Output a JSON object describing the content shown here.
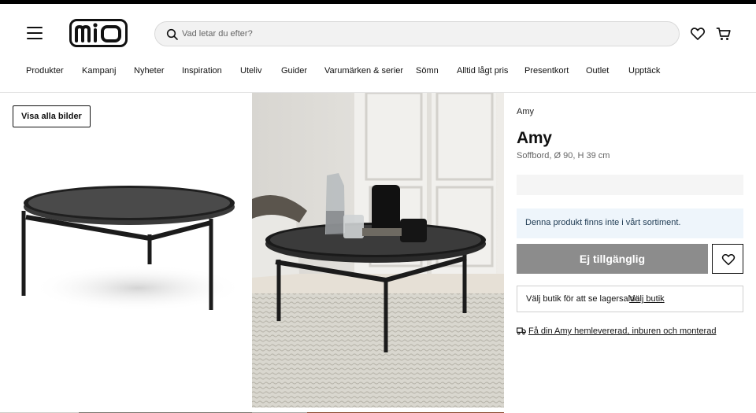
{
  "header": {
    "logo_text": "mio",
    "search_placeholder": "Vad letar du efter?",
    "icons": [
      "menu-icon",
      "search-icon",
      "heart-icon",
      "cart-icon"
    ]
  },
  "nav": {
    "items": [
      {
        "label": "Produkter"
      },
      {
        "label": "Kampanj"
      },
      {
        "label": "Nyheter"
      },
      {
        "label": "Inspiration"
      },
      {
        "label": "Uteliv"
      },
      {
        "label": "Guider"
      },
      {
        "label": "Varumärken & serier"
      },
      {
        "label": "Sömn"
      },
      {
        "label": "Alltid lågt pris"
      },
      {
        "label": "Presentkort"
      },
      {
        "label": "Outlet"
      },
      {
        "label": "Upptäck"
      }
    ]
  },
  "gallery": {
    "show_all_label": "Visa alla bilder"
  },
  "product": {
    "brand": "Amy",
    "title": "Amy",
    "subtitle": "Soffbord, Ø 90, H 39 cm",
    "notice": "Denna produkt finns inte i vårt sortiment.",
    "unavailable_label": "Ej tillgänglig",
    "store_label": "Välj butik för att se lagersaldo",
    "store_link": "Välj butik",
    "delivery_link": "Få din Amy hemlevererad, inburen och monterad"
  },
  "colors": {
    "accent_dark": "#111111",
    "button_disabled": "#8c8c8c",
    "notice_bg": "#eef5fb"
  }
}
